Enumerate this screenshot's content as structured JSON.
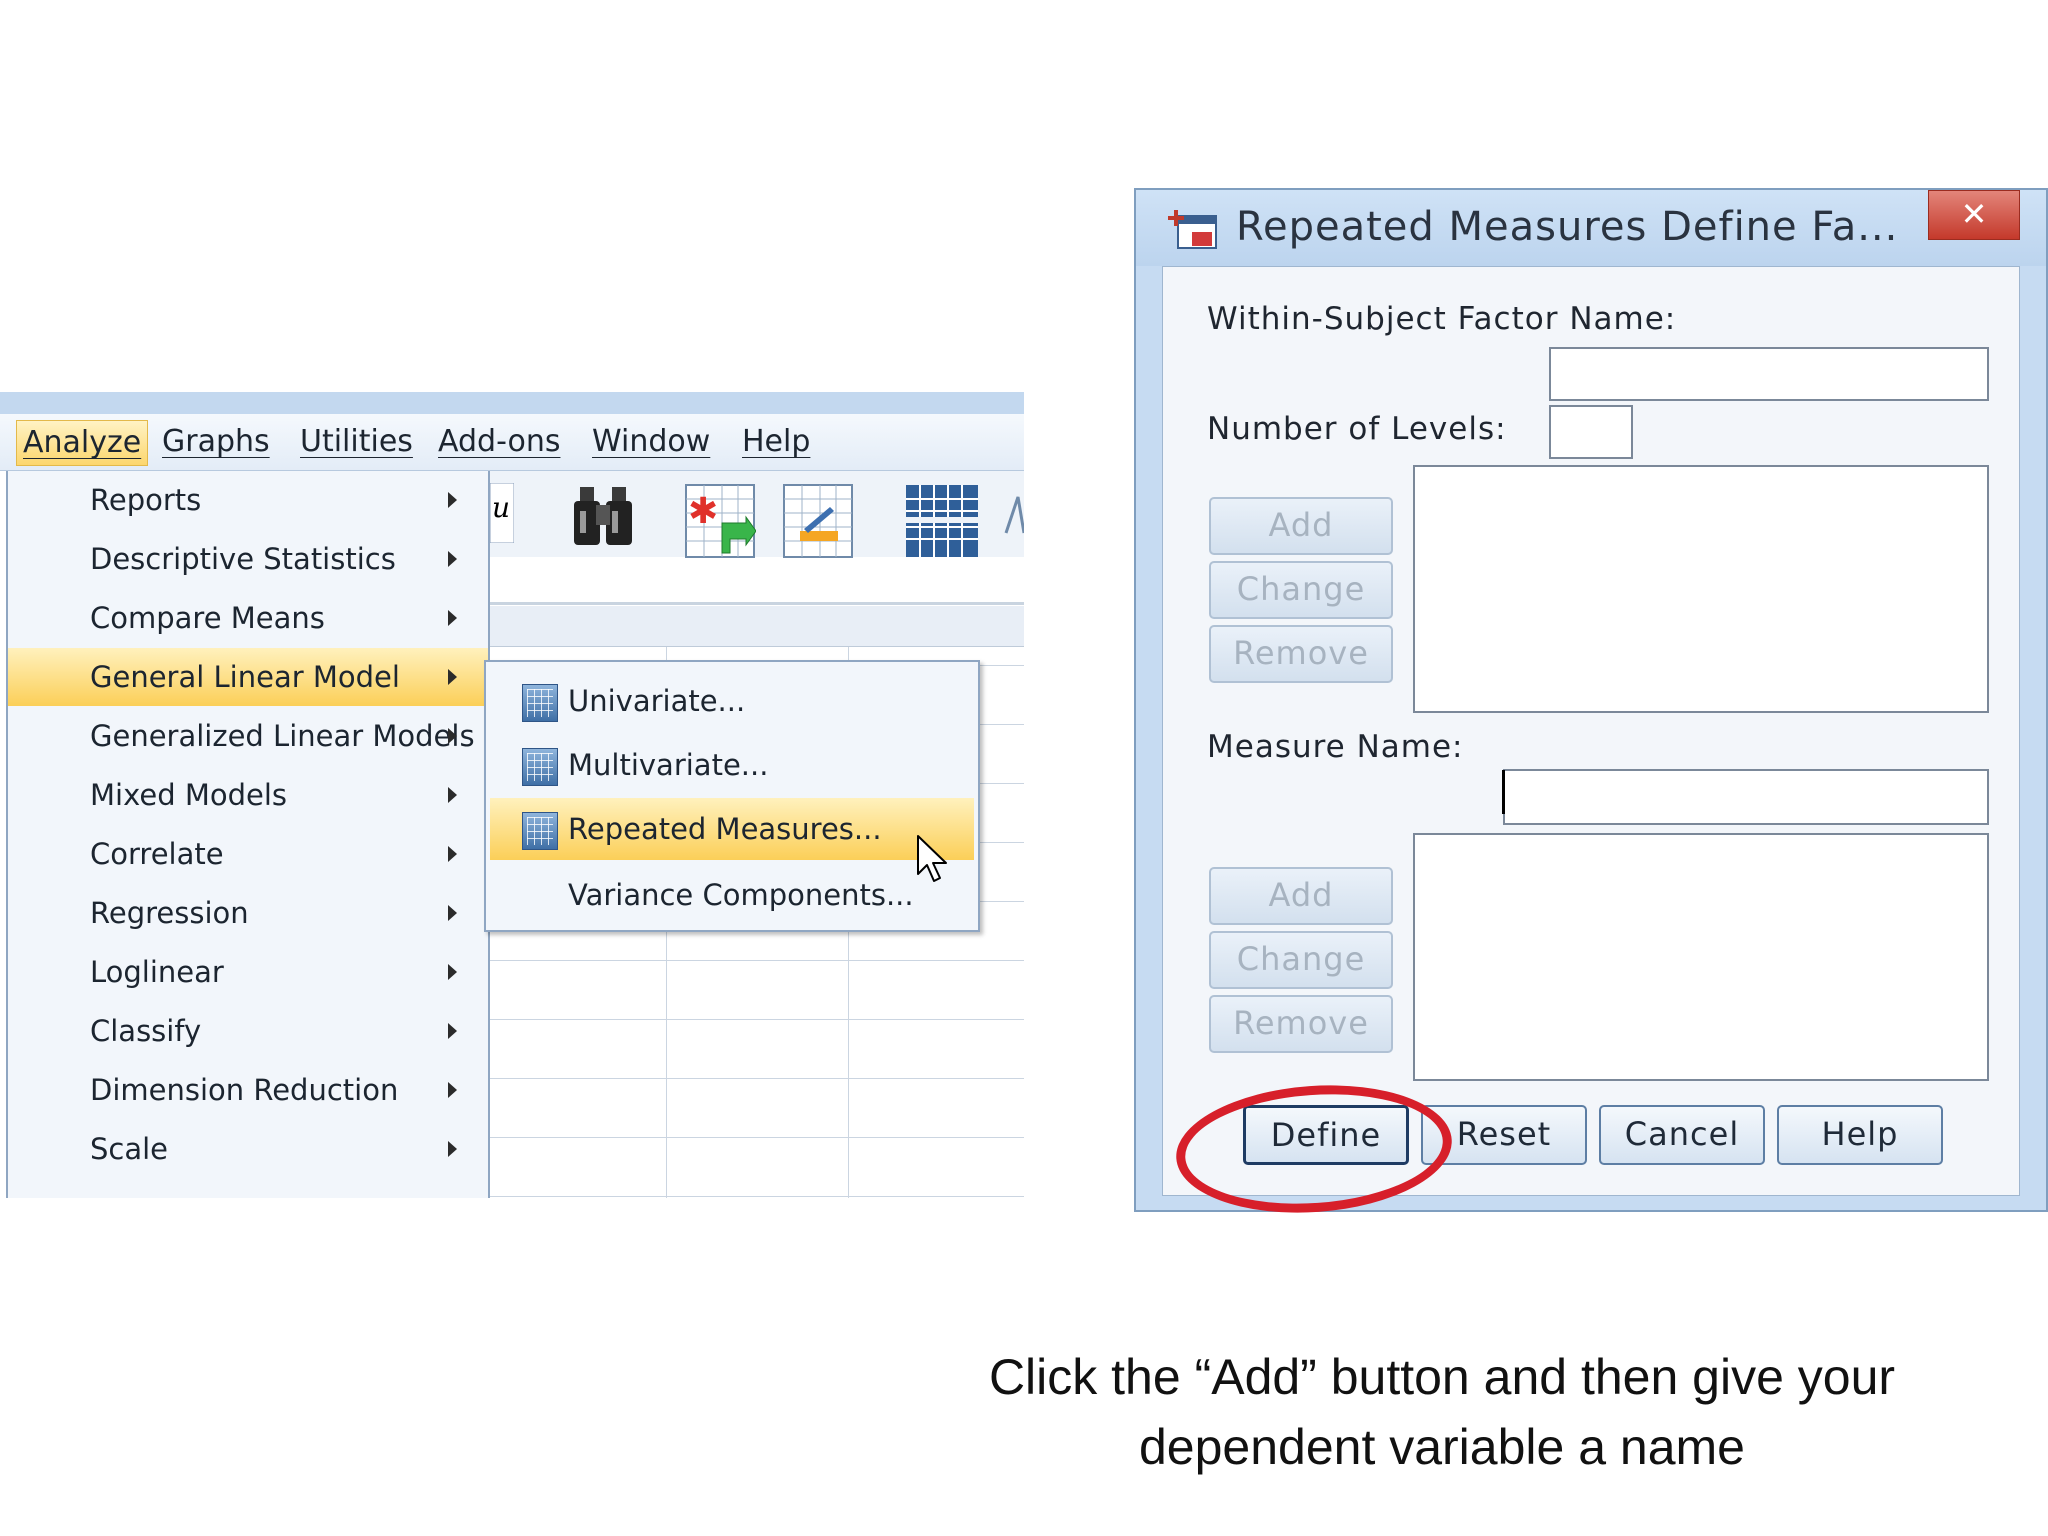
{
  "menubar": {
    "items": [
      "Analyze",
      "Graphs",
      "Utilities",
      "Add-ons",
      "Window",
      "Help"
    ]
  },
  "analyze_menu": {
    "items": [
      "Reports",
      "Descriptive Statistics",
      "Compare Means",
      "General Linear Model",
      "Generalized Linear Models",
      "Mixed Models",
      "Correlate",
      "Regression",
      "Loglinear",
      "Classify",
      "Dimension Reduction",
      "Scale"
    ],
    "active": "General Linear Model"
  },
  "glm_submenu": {
    "items": [
      "Univariate...",
      "Multivariate...",
      "Repeated Measures...",
      "Variance Components..."
    ],
    "active": "Repeated Measures..."
  },
  "dialog": {
    "title": "Repeated Measures Define Fa...",
    "close_symbol": "✕",
    "factor_name_label": "Within-Subject Factor Name:",
    "factor_name_value": "",
    "levels_label": "Number of Levels:",
    "levels_value": "",
    "measure_name_label": "Measure Name:",
    "measure_name_value": "",
    "add_label": "Add",
    "change_label": "Change",
    "remove_label": "Remove",
    "define_label": "Define",
    "reset_label": "Reset",
    "cancel_label": "Cancel",
    "help_label": "Help"
  },
  "caption": {
    "line1": "Click the “Add” button and then give your",
    "line2": "dependent variable a name"
  },
  "colors": {
    "highlight": "#fbcf58",
    "annotation_circle": "#d71f2a",
    "close_button": "#c4392b"
  },
  "icons": [
    "find-binoculars-icon",
    "insert-cases-icon",
    "chart-builder-icon",
    "data-grid-icon",
    "glm-icon",
    "mouse-pointer-icon",
    "app-icon"
  ]
}
